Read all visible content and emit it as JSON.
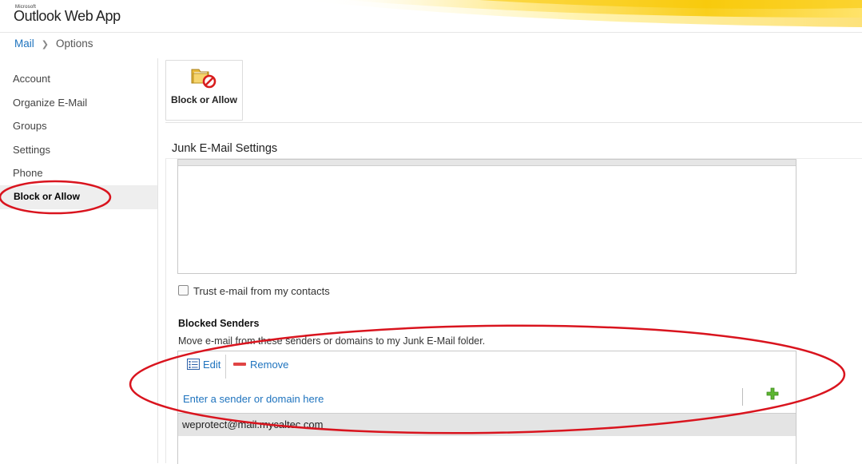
{
  "header": {
    "brand_small": "Microsoft",
    "brand_main": "Outlook Web App"
  },
  "breadcrumb": {
    "root": "Mail",
    "current": "Options"
  },
  "sidebar": {
    "items": [
      {
        "label": "Account"
      },
      {
        "label": "Organize E-Mail"
      },
      {
        "label": "Groups"
      },
      {
        "label": "Settings"
      },
      {
        "label": "Phone"
      },
      {
        "label": "Block or Allow",
        "selected": true
      }
    ]
  },
  "toolbar": {
    "tile_label": "Block or Allow",
    "tile_icon": "folder-block-icon"
  },
  "junk": {
    "section_title": "Junk E-Mail Settings",
    "trust_label": "Trust e-mail from my contacts",
    "trust_checked": false
  },
  "blocked": {
    "title": "Blocked Senders",
    "description": "Move e-mail from these senders or domains to my Junk E-Mail folder.",
    "edit_label": "Edit",
    "remove_label": "Remove",
    "input_placeholder": "Enter a sender or domain here",
    "entries": [
      "weprotect@mail.mycaltec.com"
    ]
  },
  "colors": {
    "link": "#1e73be",
    "annotation": "#d9141e",
    "add_icon": "#5cb531",
    "header_accent": "#f7c600"
  }
}
